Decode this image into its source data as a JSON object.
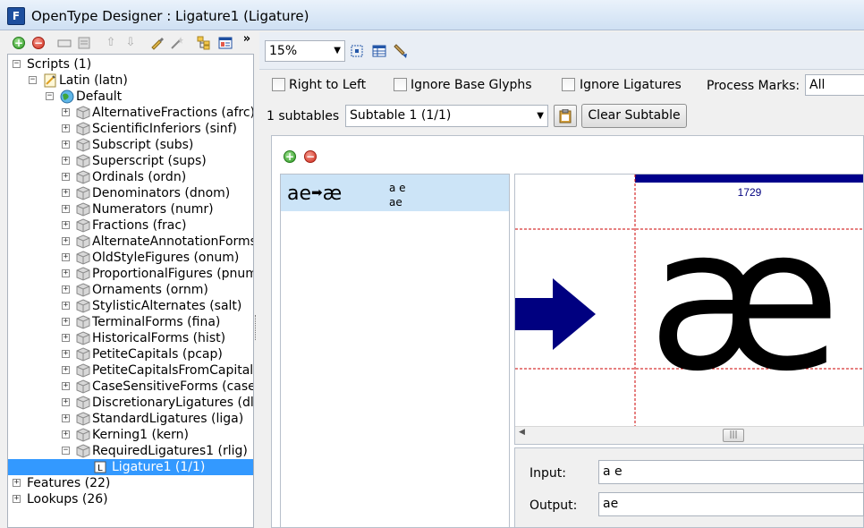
{
  "window": {
    "title": "OpenType Designer : Ligature1 (Ligature)",
    "app_icon_letter": "F"
  },
  "left_toolbar": {
    "icons": [
      "add-icon",
      "remove-icon",
      "rename-icon",
      "properties-icon",
      "move-up-icon",
      "move-down-icon",
      "edit-icon",
      "wand-icon",
      "hierarchy-icon",
      "window-icon",
      "more-icon"
    ],
    "more_label": "»"
  },
  "tree": {
    "scripts": "Scripts (1)",
    "latin": "Latin (latn)",
    "default": "Default",
    "features": [
      "AlternativeFractions (afrc)",
      "ScientificInferiors (sinf)",
      "Subscript (subs)",
      "Superscript (sups)",
      "Ordinals (ordn)",
      "Denominators (dnom)",
      "Numerators (numr)",
      "Fractions (frac)",
      "AlternateAnnotationForms",
      "OldStyleFigures (onum)",
      "ProportionalFigures (pnum",
      "Ornaments (ornm)",
      "StylisticAlternates (salt)",
      "TerminalForms (fina)",
      "HistoricalForms (hist)",
      "PetiteCapitals (pcap)",
      "PetiteCapitalsFromCapitals",
      "CaseSensitiveForms (case)",
      "DiscretionaryLigatures (dlig",
      "StandardLigatures (liga)",
      "Kerning1 (kern)",
      "RequiredLigatures1 (rlig)"
    ],
    "selected_child": "Ligature1 (1/1)",
    "features_root": "Features (22)",
    "lookups_root": "Lookups (26)"
  },
  "right_toolbar": {
    "zoom": "15%"
  },
  "options": {
    "right_to_left": "Right to Left",
    "ignore_base_glyphs": "Ignore Base Glyphs",
    "ignore_ligatures": "Ignore Ligatures",
    "process_marks_label": "Process Marks:",
    "process_marks_value": "All"
  },
  "subtables": {
    "count_label": "1 subtables",
    "selected": "Subtable 1 (1/1)",
    "clear_label": "Clear Subtable"
  },
  "rule": {
    "glyph_input": "ae",
    "glyph_output": "æ",
    "input_text": "a e",
    "output_text": "ae"
  },
  "preview": {
    "advance_width": "1729",
    "glyph": "æ",
    "colors": {
      "guide_bar": "#00008b",
      "arrow": "#000080",
      "guide_line": "#cc0000"
    }
  },
  "io": {
    "input_label": "Input:",
    "input_value": "a e",
    "output_label": "Output:",
    "output_value": "ae"
  }
}
